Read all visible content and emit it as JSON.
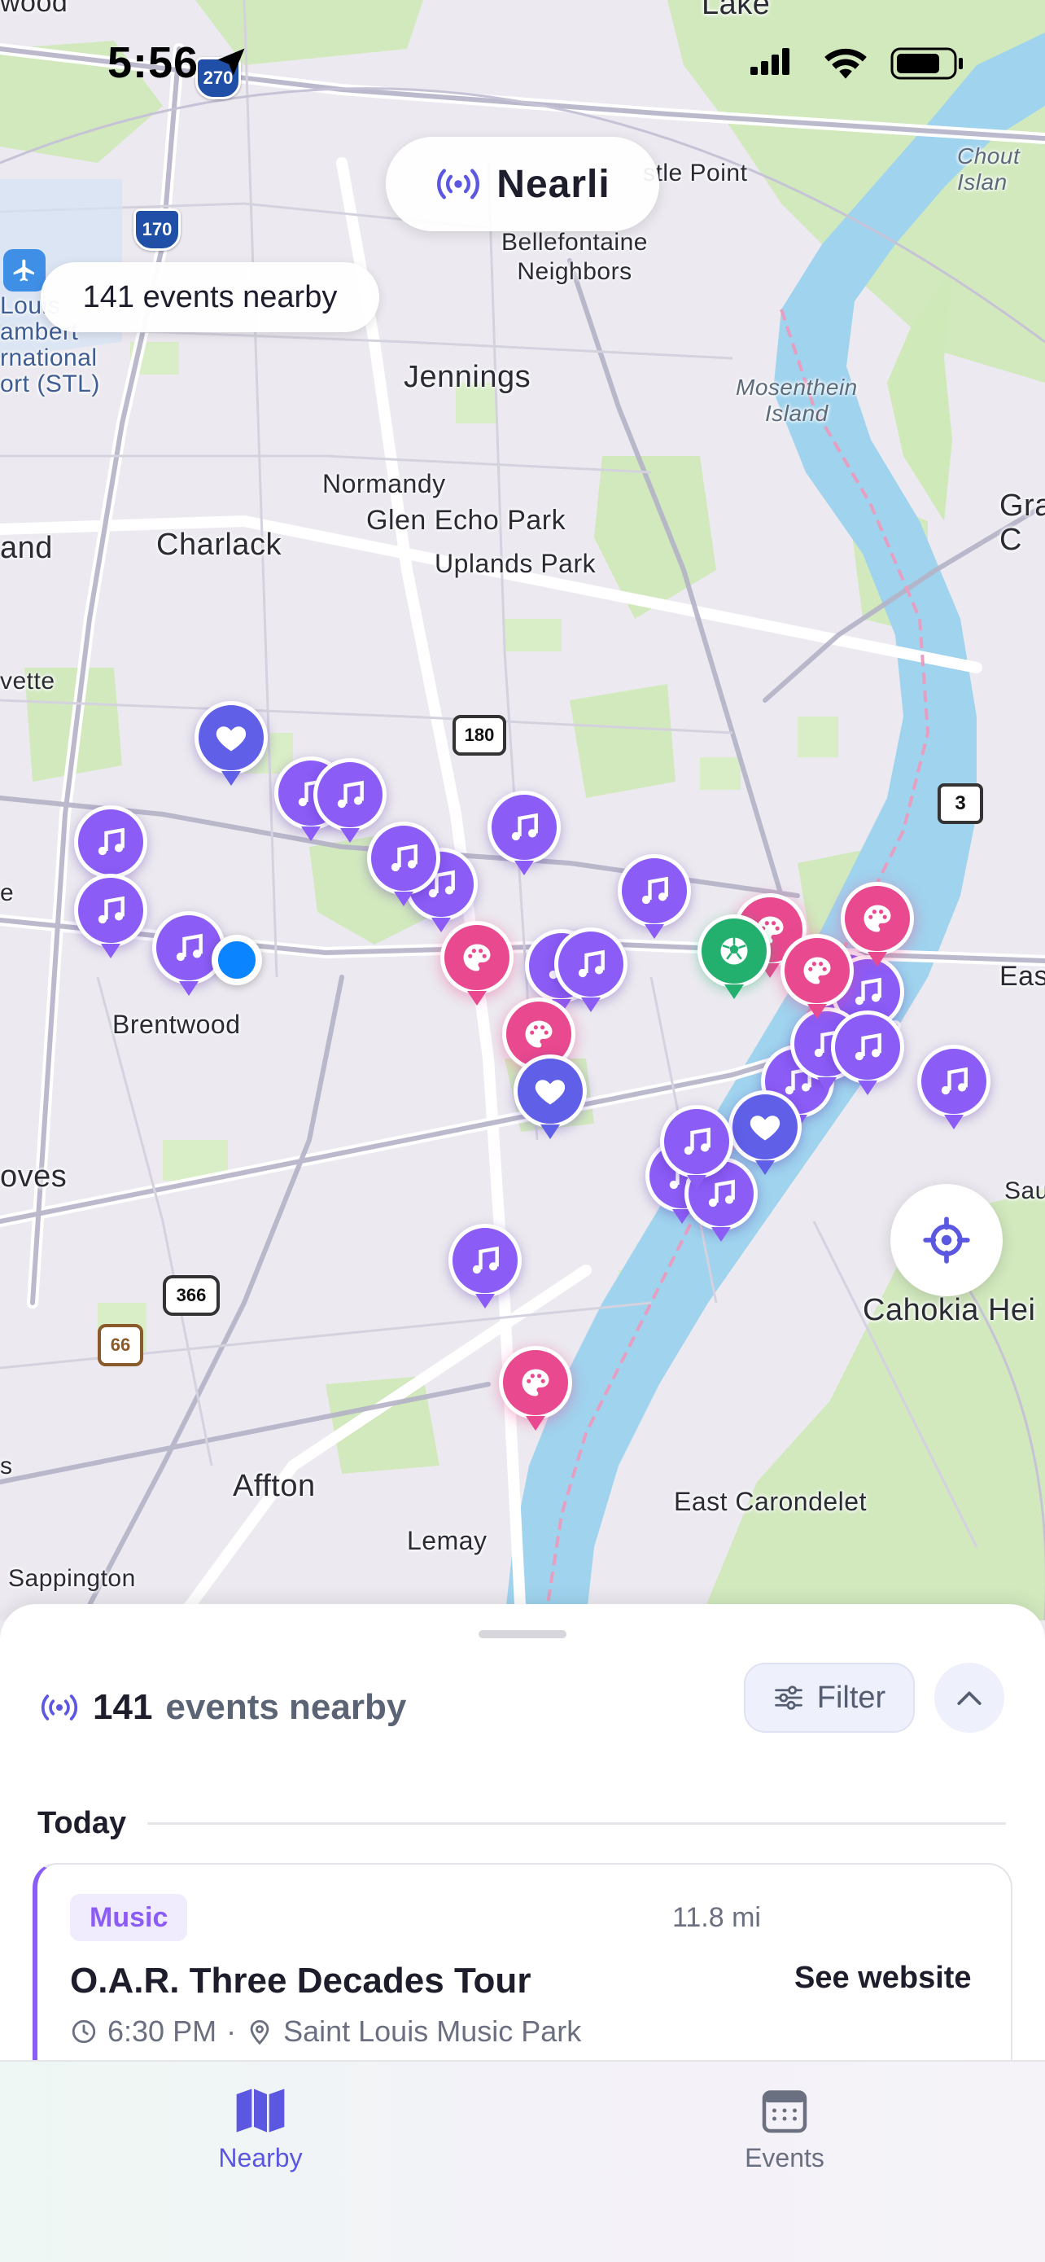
{
  "status_bar": {
    "time": "5:56"
  },
  "app": {
    "name": "Nearli"
  },
  "map": {
    "events_count_pill": "141 events nearby",
    "labels": {
      "wood": "wood",
      "lake": "Lake",
      "castle_point": "stle Point",
      "chouteau": "Chout\nIslan",
      "bellefontaine": "Bellefontaine\nNeighbors",
      "airport": "Louis\nambert\nrnational\nort (STL)",
      "jennings": "Jennings",
      "mosenthein": "Mosenthein\nIsland",
      "normandy": "Normandy",
      "glen_echo": "Glen Echo Park",
      "uplands": "Uplands Park",
      "charlack": "Charlack",
      "land": "and",
      "gra": "Gra\nC",
      "vette": "vette",
      "e": "e",
      "eas": "Eas",
      "brentwood": "Brentwood",
      "oves": "oves",
      "sauge": "Sauge",
      "cahokia": "Cahokia Hei",
      "s": "s",
      "affton": "Affton",
      "lemay": "Lemay",
      "east_carondelet": "East Carondelet",
      "sappington": "Sappington"
    },
    "shields": {
      "i270": "270",
      "i170": "170",
      "r180": "180",
      "r3": "3",
      "r366": "366",
      "us66": "66"
    },
    "marker_icons": {
      "music": "music-note-icon",
      "art": "palette-icon",
      "heart": "heart-icon",
      "sport": "soccer-ball-icon"
    }
  },
  "sheet": {
    "count": "141",
    "count_label": "events nearby",
    "filter_label": "Filter",
    "section_today": "Today",
    "events": [
      {
        "category": "Music",
        "distance": "11.8 mi",
        "title": "O.A.R. Three Decades Tour",
        "action": "See website",
        "time": "6:30 PM",
        "separator": "·",
        "venue": "Saint Louis Music Park"
      }
    ]
  },
  "tabbar": {
    "tabs": [
      {
        "label": "Nearby",
        "icon": "map-icon",
        "active": true
      },
      {
        "label": "Events",
        "icon": "calendar-icon",
        "active": false
      }
    ]
  },
  "colors": {
    "accent": "#5b57e0",
    "music": "#8b5cf6",
    "art": "#e8498f",
    "heart": "#5f5fe8",
    "sport": "#23b06f",
    "user_location": "#0a84ff"
  }
}
